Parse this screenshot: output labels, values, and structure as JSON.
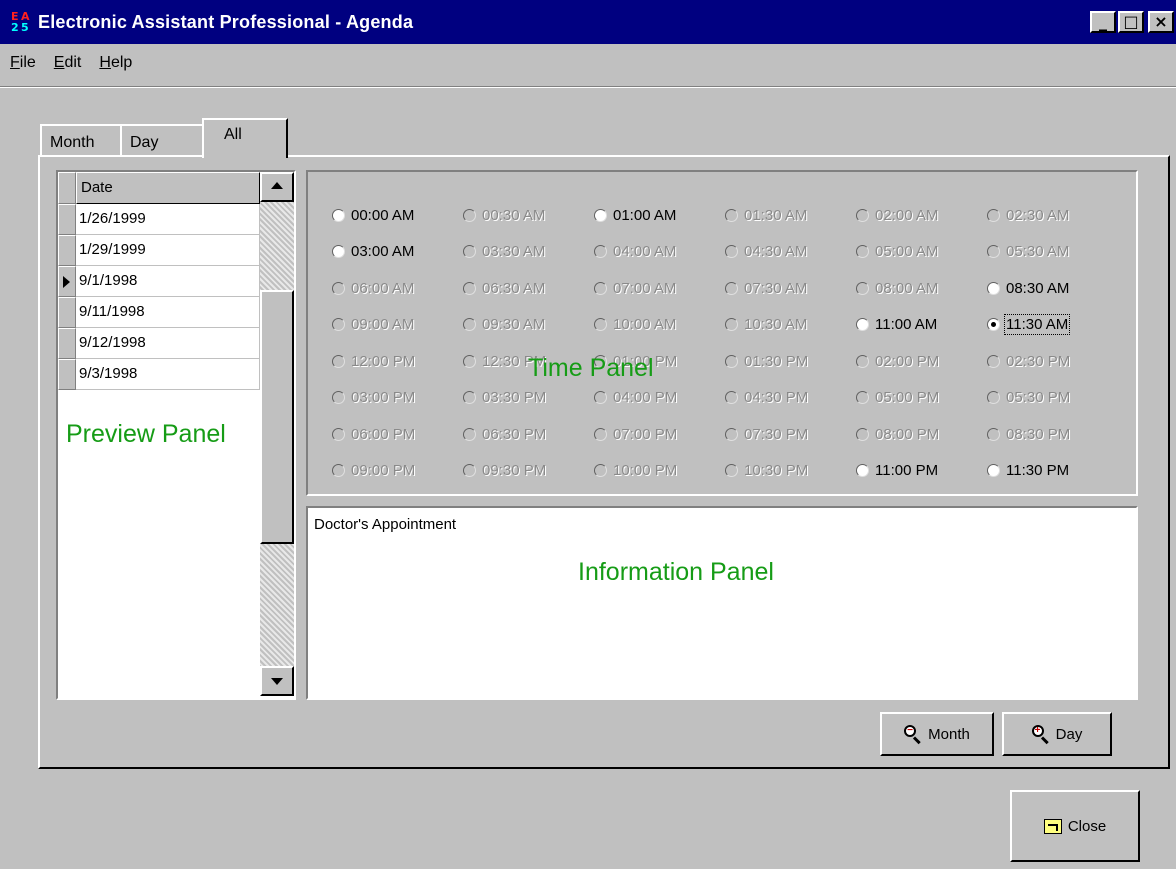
{
  "window": {
    "title": "Electronic Assistant Professional - Agenda",
    "icon_text": [
      "E",
      "A",
      "2",
      "5"
    ],
    "minimize": "_",
    "maximize": "□",
    "close": "×"
  },
  "menu": [
    {
      "accel": "F",
      "rest": "ile"
    },
    {
      "accel": "E",
      "rest": "dit"
    },
    {
      "accel": "H",
      "rest": "elp"
    }
  ],
  "tabs": {
    "month": "Month",
    "day": "Day",
    "all": "All",
    "selected": "All"
  },
  "preview": {
    "column_header": "Date",
    "rows": [
      "1/26/1999",
      "1/29/1999",
      "9/1/1998",
      "9/11/1998",
      "9/12/1998",
      "9/3/1998"
    ],
    "current_row_index": 2
  },
  "time_slots": [
    {
      "label": "00:00 AM",
      "enabled": true,
      "checked": false
    },
    {
      "label": "00:30 AM",
      "enabled": false,
      "checked": false
    },
    {
      "label": "01:00 AM",
      "enabled": true,
      "checked": false
    },
    {
      "label": "01:30 AM",
      "enabled": false,
      "checked": false
    },
    {
      "label": "02:00 AM",
      "enabled": false,
      "checked": false
    },
    {
      "label": "02:30 AM",
      "enabled": false,
      "checked": false
    },
    {
      "label": "03:00 AM",
      "enabled": true,
      "checked": false
    },
    {
      "label": "03:30 AM",
      "enabled": false,
      "checked": false
    },
    {
      "label": "04:00 AM",
      "enabled": false,
      "checked": false
    },
    {
      "label": "04:30 AM",
      "enabled": false,
      "checked": false
    },
    {
      "label": "05:00 AM",
      "enabled": false,
      "checked": false
    },
    {
      "label": "05:30 AM",
      "enabled": false,
      "checked": false
    },
    {
      "label": "06:00 AM",
      "enabled": false,
      "checked": false
    },
    {
      "label": "06:30 AM",
      "enabled": false,
      "checked": false
    },
    {
      "label": "07:00 AM",
      "enabled": false,
      "checked": false
    },
    {
      "label": "07:30 AM",
      "enabled": false,
      "checked": false
    },
    {
      "label": "08:00 AM",
      "enabled": false,
      "checked": false
    },
    {
      "label": "08:30 AM",
      "enabled": true,
      "checked": false
    },
    {
      "label": "09:00 AM",
      "enabled": false,
      "checked": false
    },
    {
      "label": "09:30 AM",
      "enabled": false,
      "checked": false
    },
    {
      "label": "10:00 AM",
      "enabled": false,
      "checked": false
    },
    {
      "label": "10:30 AM",
      "enabled": false,
      "checked": false
    },
    {
      "label": "11:00 AM",
      "enabled": true,
      "checked": false
    },
    {
      "label": "11:30 AM",
      "enabled": true,
      "checked": true,
      "focused": true
    },
    {
      "label": "12:00 PM",
      "enabled": false,
      "checked": false
    },
    {
      "label": "12:30 PM",
      "enabled": false,
      "checked": false
    },
    {
      "label": "01:00 PM",
      "enabled": false,
      "checked": false
    },
    {
      "label": "01:30 PM",
      "enabled": false,
      "checked": false
    },
    {
      "label": "02:00 PM",
      "enabled": false,
      "checked": false
    },
    {
      "label": "02:30 PM",
      "enabled": false,
      "checked": false
    },
    {
      "label": "03:00 PM",
      "enabled": false,
      "checked": false
    },
    {
      "label": "03:30 PM",
      "enabled": false,
      "checked": false
    },
    {
      "label": "04:00 PM",
      "enabled": false,
      "checked": false
    },
    {
      "label": "04:30 PM",
      "enabled": false,
      "checked": false
    },
    {
      "label": "05:00 PM",
      "enabled": false,
      "checked": false
    },
    {
      "label": "05:30 PM",
      "enabled": false,
      "checked": false
    },
    {
      "label": "06:00 PM",
      "enabled": false,
      "checked": false
    },
    {
      "label": "06:30 PM",
      "enabled": false,
      "checked": false
    },
    {
      "label": "07:00 PM",
      "enabled": false,
      "checked": false
    },
    {
      "label": "07:30 PM",
      "enabled": false,
      "checked": false
    },
    {
      "label": "08:00 PM",
      "enabled": false,
      "checked": false
    },
    {
      "label": "08:30 PM",
      "enabled": false,
      "checked": false
    },
    {
      "label": "09:00 PM",
      "enabled": false,
      "checked": false
    },
    {
      "label": "09:30 PM",
      "enabled": false,
      "checked": false
    },
    {
      "label": "10:00 PM",
      "enabled": false,
      "checked": false
    },
    {
      "label": "10:30 PM",
      "enabled": false,
      "checked": false
    },
    {
      "label": "11:00 PM",
      "enabled": true,
      "checked": false
    },
    {
      "label": "11:30 PM",
      "enabled": true,
      "checked": false
    }
  ],
  "info": {
    "text": "Doctor's Appointment"
  },
  "annotations": {
    "preview": "Preview Panel",
    "time": "Time Panel",
    "info": "Information Panel",
    "color": "#169c16"
  },
  "buttons": {
    "month": "Month",
    "day": "Day",
    "close": "Close"
  },
  "icons": {
    "zoom_out": "zoom-out-icon",
    "zoom_in": "zoom-in-icon",
    "close": "close-door-icon"
  },
  "colors": {
    "titlebar": "#000080",
    "face": "#c0c0c0",
    "disabled_text": "#8a8a8a"
  }
}
